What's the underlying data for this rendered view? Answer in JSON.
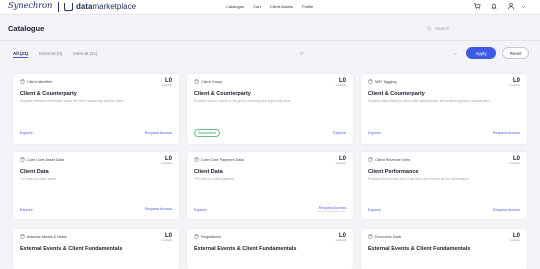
{
  "header": {
    "brand": "Synechron",
    "product_prefix": "data",
    "product_suffix": "marketplace",
    "nav": [
      "Catalogue",
      "Cart",
      "Client Assets",
      "Profile"
    ]
  },
  "page": {
    "title": "Catalogue",
    "search_placeholder": "Search"
  },
  "tabs": [
    {
      "label": "All (21)",
      "active": true
    },
    {
      "label": "External (0)",
      "active": false
    },
    {
      "label": "Internal (21)",
      "active": false
    }
  ],
  "filters": {
    "select1_value": "IT",
    "select2_value": "",
    "apply_label": "Apply",
    "reset_label": "Reset"
  },
  "cards": [
    {
      "source": "Client Identifier",
      "level": "L0",
      "level_sub": "Available",
      "title": "Client & Counterparty",
      "desc": "Supplies reference information about the firm's relationship with the client",
      "footer_left": "Explore",
      "footer_left_type": "link",
      "footer_right": "Request Access"
    },
    {
      "source": "Client Group",
      "level": "L0",
      "level_sub": "Available",
      "title": "Client & Counterparty",
      "desc": "Provides data on clients at the group, hierarchy and legal entity level",
      "footer_left": "Subscribed",
      "footer_left_type": "badge",
      "footer_right": "Explore"
    },
    {
      "source": "MiFi Tagging",
      "level": "L0",
      "level_sub": "Available",
      "title": "Client & Counterparty",
      "desc": "Supplies data relating to client mifid categorisation and related regulatory classification",
      "footer_left": "Explore",
      "footer_left_type": "link",
      "footer_right": "Request Access"
    },
    {
      "source": "Core Core Asset Data",
      "level": "L0",
      "level_sub": "Available",
      "title": "Client Data",
      "desc": "The data of a client asset",
      "footer_left": "Explore",
      "footer_left_type": "link",
      "footer_right": "Request Access"
    },
    {
      "source": "Core Core Payment Data",
      "level": "L0",
      "level_sub": "Available",
      "title": "Client Data",
      "desc": "The data of a client payment",
      "footer_left": "Explore",
      "footer_left_type": "link",
      "footer_right": "Request Access"
    },
    {
      "source": "Client Revenue View",
      "level": "L0",
      "level_sub": "Available",
      "title": "Client Performance",
      "desc": "Provides the revenue view of the client and metrics for the performance",
      "footer_left": "Explore",
      "footer_left_type": "link",
      "footer_right": "Request Access"
    },
    {
      "source": "Adverse Media & News",
      "level": "L0",
      "level_sub": "Available",
      "title": "External Events & Client Fundamentals",
      "desc": "",
      "footer_left": "",
      "footer_left_type": "link",
      "footer_right": ""
    },
    {
      "source": "Regulations",
      "level": "L0",
      "level_sub": "Available",
      "title": "External Events & Client Fundamentals",
      "desc": "",
      "footer_left": "",
      "footer_left_type": "link",
      "footer_right": ""
    },
    {
      "source": "Economic Data",
      "level": "L0",
      "level_sub": "Available",
      "title": "External Events & Client Fundamentals",
      "desc": "",
      "footer_left": "",
      "footer_left_type": "link",
      "footer_right": ""
    }
  ]
}
